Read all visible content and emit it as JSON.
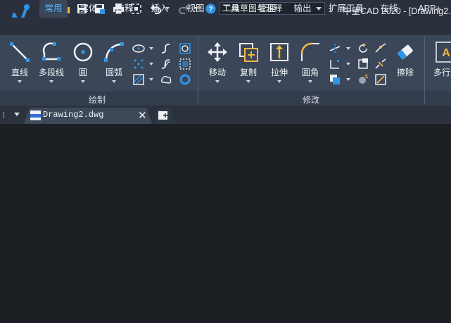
{
  "window": {
    "title": "中望CAD 2020 - [Drawing2.",
    "workspace": "二维草图与注释"
  },
  "quick_access": {
    "icons": [
      "new-file-icon",
      "open-folder-icon",
      "save-icon",
      "save-as-icon",
      "print-icon",
      "zoom-extents-icon",
      "undo-icon",
      "redo-icon",
      "customize-icon",
      "help-icon"
    ]
  },
  "tabs": [
    {
      "label": "常用",
      "active": true
    },
    {
      "label": "实体"
    },
    {
      "label": "注释"
    },
    {
      "label": "插入"
    },
    {
      "label": "视图"
    },
    {
      "label": "工具"
    },
    {
      "label": "管理"
    },
    {
      "label": "输出"
    },
    {
      "label": "扩展工具"
    },
    {
      "label": "在线"
    },
    {
      "label": "APP+"
    }
  ],
  "ribbon": {
    "draw": {
      "label": "绘制",
      "tools": [
        {
          "label": "直线",
          "icon": "line-icon"
        },
        {
          "label": "多段线",
          "icon": "polyline-icon"
        },
        {
          "label": "圆",
          "icon": "circle-icon"
        },
        {
          "label": "圆弧",
          "icon": "arc-icon"
        }
      ]
    },
    "modify": {
      "label": "修改",
      "tools": [
        {
          "label": "移动",
          "icon": "move-icon"
        },
        {
          "label": "复制",
          "icon": "copy-icon"
        },
        {
          "label": "拉伸",
          "icon": "stretch-icon"
        },
        {
          "label": "圆角",
          "icon": "fillet-icon"
        },
        {
          "label": "擦除",
          "icon": "erase-icon"
        }
      ]
    },
    "annotation": {
      "tools": [
        {
          "label": "多行文",
          "icon": "mtext-icon"
        }
      ]
    }
  },
  "document": {
    "tab_label": "Drawing2.dwg",
    "close_symbol": "✕"
  },
  "colors": {
    "accent": "#4fb4ff",
    "ribbon_bg": "#3b4658",
    "canvas_bg": "#1c1f24"
  }
}
